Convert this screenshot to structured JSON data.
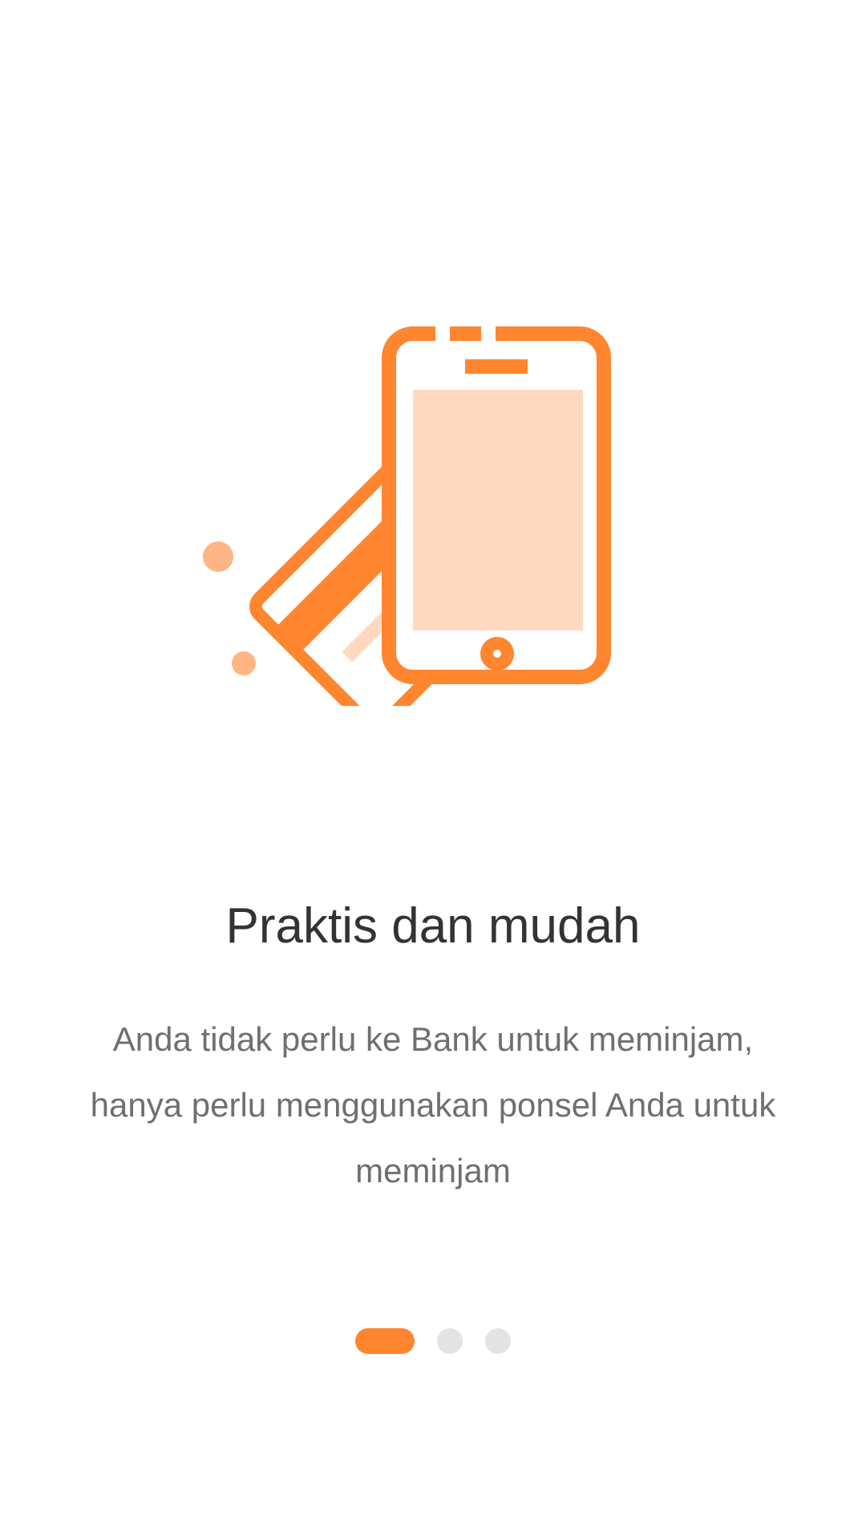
{
  "onboarding": {
    "title": "Praktis dan mudah",
    "description_lines": [
      "Anda tidak perlu ke Bank untuk meminjam,",
      "hanya perlu menggunakan ponsel Anda untuk",
      "meminjam"
    ],
    "illustration": {
      "icon": "card-and-phone-icon",
      "primary_color": "#ff852f",
      "light_color": "#fed9bf",
      "dot_color": "#ffb584"
    }
  },
  "pager": {
    "total_pages": 3,
    "current_page": 1,
    "active_color": "#ff852f",
    "inactive_color": "#e3e3e3"
  }
}
